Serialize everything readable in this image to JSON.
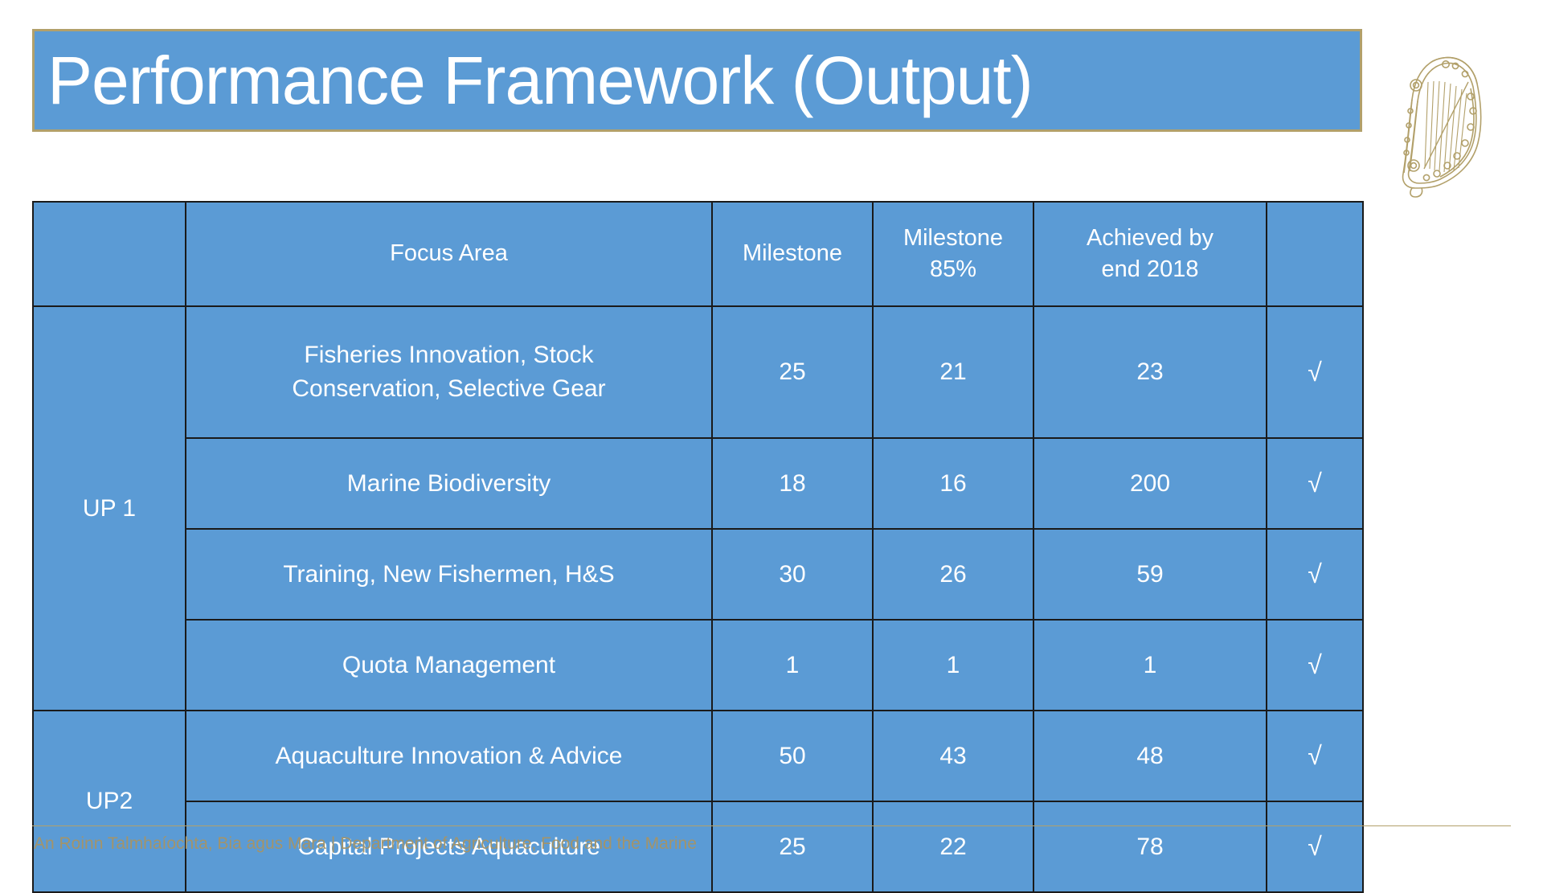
{
  "slide": {
    "title": "Performance Framework (Output)",
    "accent_blue": "#5B9BD5",
    "accent_gold": "#B2A06A",
    "border_color": "#1a1a1a",
    "text_color": "#FFFFFF"
  },
  "logo": {
    "name": "irish-harp-emblem",
    "color": "#B2A06A"
  },
  "table": {
    "headers": {
      "up": "",
      "focus_area": "Focus Area",
      "milestone": "Milestone",
      "milestone_85_line1": "Milestone",
      "milestone_85_line2": "85%",
      "achieved_line1": "Achieved by",
      "achieved_line2": "end 2018",
      "tick": ""
    },
    "groups": [
      {
        "label": "UP 1",
        "rowspan": 4
      },
      {
        "label": "UP2",
        "rowspan": 2
      }
    ],
    "rows": [
      {
        "group": "UP 1",
        "focus_area_line1": "Fisheries Innovation, Stock",
        "focus_area_line2": "Conservation, Selective Gear",
        "milestone": "25",
        "milestone_85": "21",
        "achieved_end_2018": "23",
        "tick": "√"
      },
      {
        "group": "UP 1",
        "focus_area_line1": "Marine Biodiversity",
        "focus_area_line2": "",
        "milestone": "18",
        "milestone_85": "16",
        "achieved_end_2018": "200",
        "tick": "√"
      },
      {
        "group": "UP 1",
        "focus_area_line1": "Training, New Fishermen, H&S",
        "focus_area_line2": "",
        "milestone": "30",
        "milestone_85": "26",
        "achieved_end_2018": "59",
        "tick": "√"
      },
      {
        "group": "UP 1",
        "focus_area_line1": "Quota Management",
        "focus_area_line2": "",
        "milestone": "1",
        "milestone_85": "1",
        "achieved_end_2018": "1",
        "tick": "√"
      },
      {
        "group": "UP2",
        "focus_area_line1": "Aquaculture Innovation & Advice",
        "focus_area_line2": "",
        "milestone": "50",
        "milestone_85": "43",
        "achieved_end_2018": "48",
        "tick": "√"
      },
      {
        "group": "UP2",
        "focus_area_line1": "Capital Projects Aquaculture",
        "focus_area_line2": "",
        "milestone": "25",
        "milestone_85": "22",
        "achieved_end_2018": "78",
        "tick": "√"
      }
    ]
  },
  "footer": {
    "irish": "An Roinn Talmhaíochta, Bia agus Mara",
    "separator": "|",
    "english": "Department of Agriculture, Food and the Marine"
  }
}
